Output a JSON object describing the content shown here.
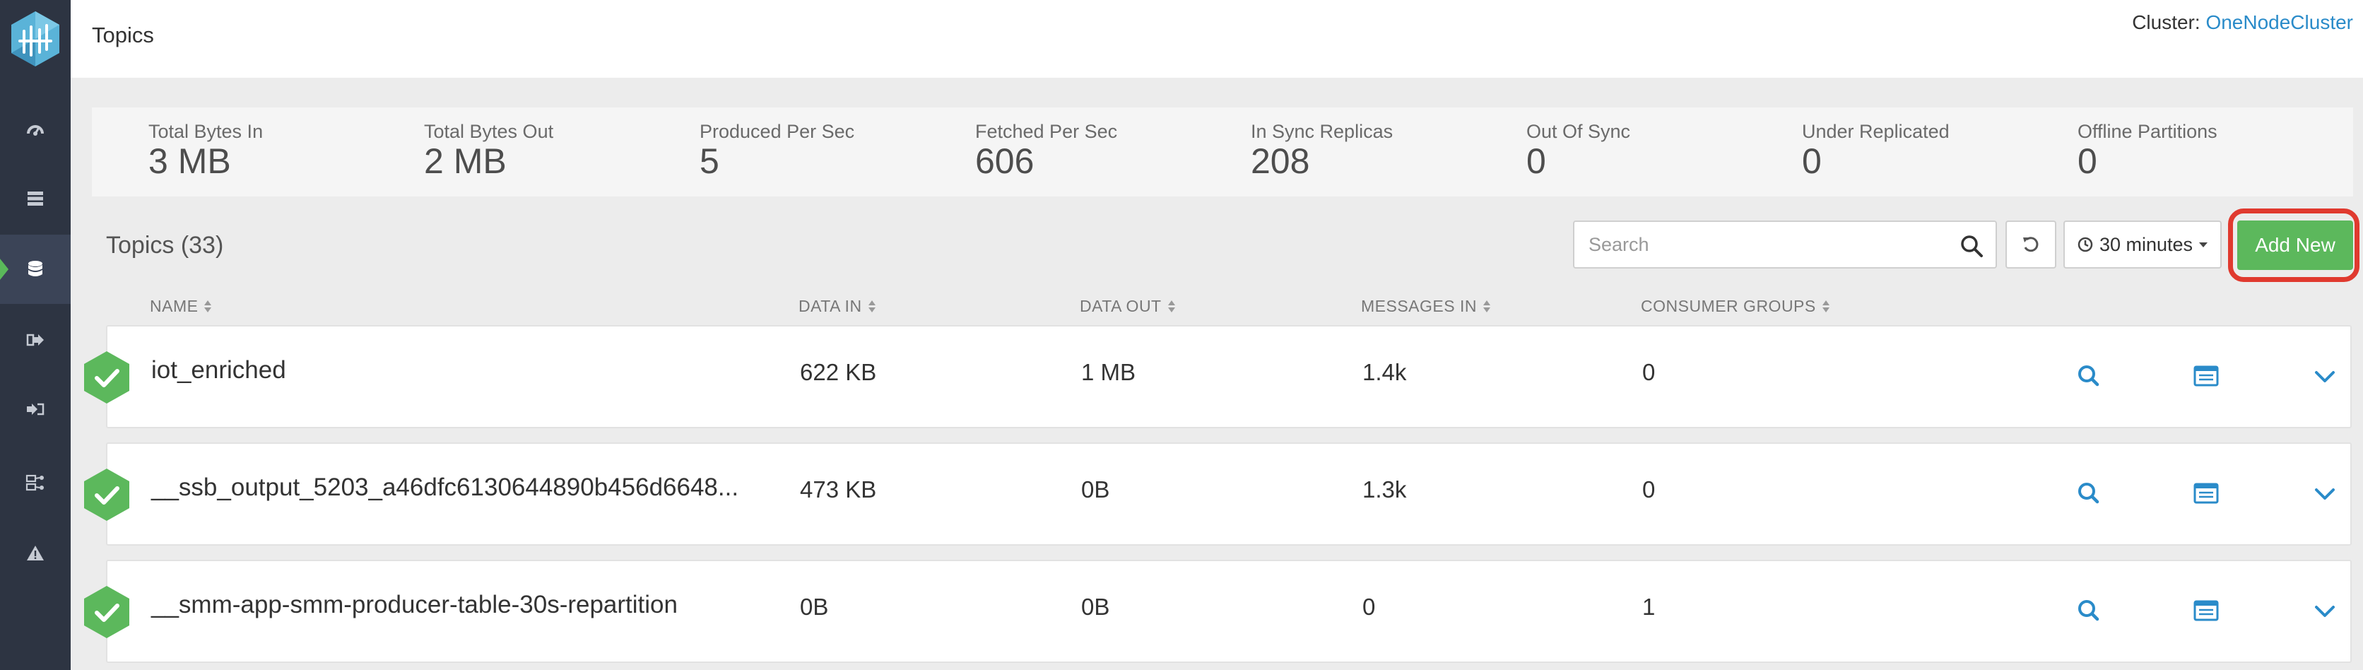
{
  "header": {
    "title": "Topics",
    "cluster_label": "Cluster:",
    "cluster_name": "OneNodeCluster"
  },
  "sidebar": {
    "items": [
      {
        "icon": "dashboard-icon"
      },
      {
        "icon": "brokers-icon"
      },
      {
        "icon": "topics-icon",
        "active": true
      },
      {
        "icon": "producers-icon"
      },
      {
        "icon": "consumers-icon"
      },
      {
        "icon": "data-lineage-icon"
      },
      {
        "icon": "alerts-icon"
      }
    ]
  },
  "stats": [
    {
      "label": "Total Bytes In",
      "value": "3 MB"
    },
    {
      "label": "Total Bytes Out",
      "value": "2 MB"
    },
    {
      "label": "Produced Per Sec",
      "value": "5"
    },
    {
      "label": "Fetched Per Sec",
      "value": "606"
    },
    {
      "label": "In Sync Replicas",
      "value": "208"
    },
    {
      "label": "Out Of Sync",
      "value": "0"
    },
    {
      "label": "Under Replicated",
      "value": "0"
    },
    {
      "label": "Offline Partitions",
      "value": "0"
    }
  ],
  "toolbar": {
    "topics_count": "Topics (33)",
    "search_placeholder": "Search",
    "time_range": "30 minutes",
    "add_label": "Add New"
  },
  "columns": [
    "NAME",
    "DATA IN",
    "DATA OUT",
    "MESSAGES IN",
    "CONSUMER GROUPS"
  ],
  "rows": [
    {
      "name": "iot_enriched",
      "data_in": "622 KB",
      "data_out": "1 MB",
      "messages_in": "1.4k",
      "consumer_groups": "0"
    },
    {
      "name": "__ssb_output_5203_a46dfc6130644890b456d6648...",
      "data_in": "473 KB",
      "data_out": "0B",
      "messages_in": "1.3k",
      "consumer_groups": "0"
    },
    {
      "name": "__smm-app-smm-producer-table-30s-repartition",
      "data_in": "0B",
      "data_out": "0B",
      "messages_in": "0",
      "consumer_groups": "1"
    }
  ],
  "colors": {
    "sidebar_bg": "#2d3442",
    "accent_green": "#5cb85c",
    "link_blue": "#2a8bc9",
    "highlight_red": "#e03a2f"
  }
}
